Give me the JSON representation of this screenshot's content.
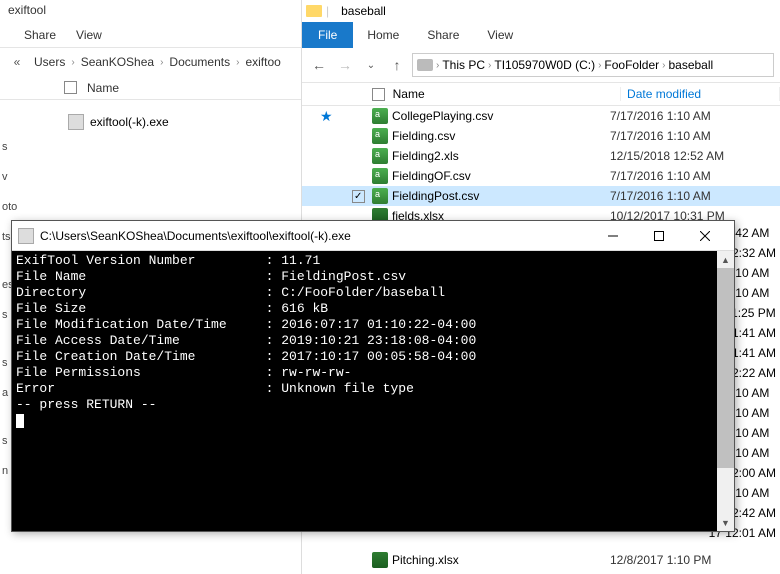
{
  "left": {
    "title": "exiftool",
    "tabs": {
      "share": "Share",
      "view": "View"
    },
    "crumbs": [
      "Users",
      "SeanKOShea",
      "Documents",
      "exiftoo"
    ],
    "cols": {
      "name": "Name"
    },
    "file": {
      "name": "exiftool(-k).exe"
    },
    "sideLabels": [
      "s",
      "v",
      "oto",
      "ts",
      " ",
      "es",
      "s",
      " ",
      "s",
      "a",
      " ",
      "s",
      "n Infor"
    ]
  },
  "right": {
    "title": "baseball",
    "ribbon": {
      "file": "File",
      "home": "Home",
      "share": "Share",
      "view": "View"
    },
    "path": [
      "This PC",
      "TI105970W0D (C:)",
      "FooFolder",
      "baseball"
    ],
    "cols": {
      "name": "Name",
      "date": "Date modified"
    },
    "files": [
      {
        "name": "CollegePlaying.csv",
        "date": "7/17/2016 1:10 AM",
        "icon": "csv",
        "sel": false
      },
      {
        "name": "Fielding.csv",
        "date": "7/17/2016 1:10 AM",
        "icon": "csv",
        "sel": false
      },
      {
        "name": "Fielding2.xls",
        "date": "12/15/2018 12:52 AM",
        "icon": "csv",
        "sel": false
      },
      {
        "name": "FieldingOF.csv",
        "date": "7/17/2016 1:10 AM",
        "icon": "csv",
        "sel": false
      },
      {
        "name": "FieldingPost.csv",
        "date": "7/17/2016 1:10 AM",
        "icon": "csv",
        "sel": true
      },
      {
        "name": "fields.xlsx",
        "date": "10/12/2017 10:31 PM",
        "icon": "xls",
        "sel": false
      }
    ],
    "partialDates": [
      "8 12:42 AM",
      "017 2:32 AM",
      "16 1:10 AM",
      "16 1:10 AM",
      "18 11:25 PM",
      "017 1:41 AM",
      "017 1:41 AM",
      "19 12:22 AM",
      "16 1:10 AM",
      "16 1:10 AM",
      "16 1:10 AM",
      "16 1:10 AM",
      "17 12:00 AM",
      "16 1:10 AM",
      "19 12:42 AM",
      "17 12:01 AM"
    ],
    "bottomFile": {
      "name": "Pitching.xlsx",
      "date": "12/8/2017 1:10 PM"
    }
  },
  "console": {
    "title": "C:\\Users\\SeanKOShea\\Documents\\exiftool\\exiftool(-k).exe",
    "lines": [
      "ExifTool Version Number         : 11.71",
      "File Name                       : FieldingPost.csv",
      "Directory                       : C:/FooFolder/baseball",
      "File Size                       : 616 kB",
      "File Modification Date/Time     : 2016:07:17 01:10:22-04:00",
      "File Access Date/Time           : 2019:10:21 23:18:08-04:00",
      "File Creation Date/Time         : 2017:10:17 00:05:58-04:00",
      "File Permissions                : rw-rw-rw-",
      "Error                           : Unknown file type",
      "-- press RETURN --"
    ]
  }
}
